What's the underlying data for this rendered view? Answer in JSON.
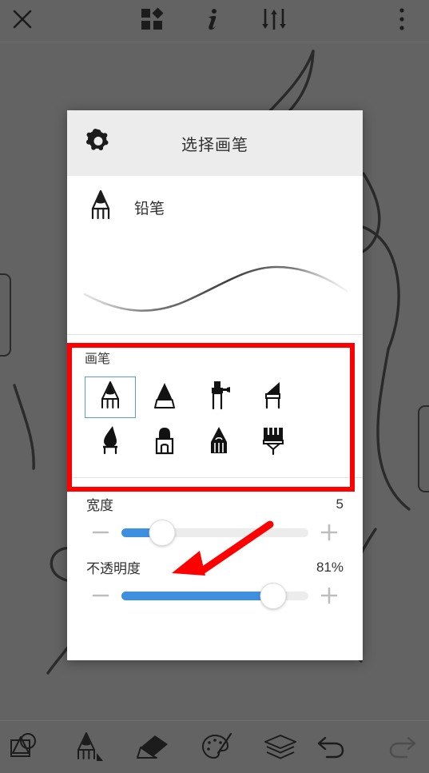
{
  "app": {
    "canvas_bg": "#636363",
    "accent": "#3d8fe0",
    "annotation_color": "#ff0000"
  },
  "topbar": {
    "close_label": "close-icon",
    "items": [
      {
        "name": "close",
        "icon": "close-icon"
      },
      {
        "name": "templates",
        "icon": "shapes-grid-icon"
      },
      {
        "name": "info",
        "icon": "info-icon"
      },
      {
        "name": "adjust",
        "icon": "sliders-icon"
      },
      {
        "name": "more",
        "icon": "overflow-menu-icon"
      }
    ]
  },
  "dialog": {
    "title": "选择画笔",
    "gear_icon": "gear-icon",
    "current_brush": {
      "icon": "pencil-icon",
      "label": "铅笔"
    },
    "preview": {
      "stroke_color": "#555555"
    },
    "brush_section": {
      "title": "画笔",
      "selected_index": 0,
      "items": [
        {
          "name": "pencil",
          "icon": "pencil-outline-icon",
          "selected": true
        },
        {
          "name": "pen",
          "icon": "pen-icon",
          "selected": false
        },
        {
          "name": "airbrush",
          "icon": "airbrush-icon",
          "selected": false
        },
        {
          "name": "chisel-marker",
          "icon": "chisel-marker-icon",
          "selected": false
        },
        {
          "name": "ink-brush",
          "icon": "ink-brush-icon",
          "selected": false
        },
        {
          "name": "marker",
          "icon": "marker-icon",
          "selected": false
        },
        {
          "name": "solid-pencil",
          "icon": "solid-pencil-icon",
          "selected": false
        },
        {
          "name": "paint-brush",
          "icon": "paint-brush-icon",
          "selected": false
        }
      ]
    },
    "sliders": [
      {
        "name": "width",
        "label": "宽度",
        "value_text": "5",
        "percent": 22,
        "minus_label": "−",
        "plus_label": "+"
      },
      {
        "name": "opacity",
        "label": "不透明度",
        "value_text": "81%",
        "percent": 81,
        "minus_label": "−",
        "plus_label": "+"
      }
    ]
  },
  "bottombar": {
    "left_items": [
      {
        "name": "transform",
        "icon": "transform-shapes-icon"
      },
      {
        "name": "brush-tool",
        "icon": "pencil-tool-icon"
      },
      {
        "name": "eraser-tool",
        "icon": "eraser-icon"
      },
      {
        "name": "color-palette",
        "icon": "palette-icon"
      },
      {
        "name": "layers",
        "icon": "layers-icon"
      }
    ],
    "right_items": [
      {
        "name": "undo",
        "icon": "undo-icon",
        "enabled": true
      },
      {
        "name": "redo",
        "icon": "redo-icon",
        "enabled": false
      }
    ]
  }
}
